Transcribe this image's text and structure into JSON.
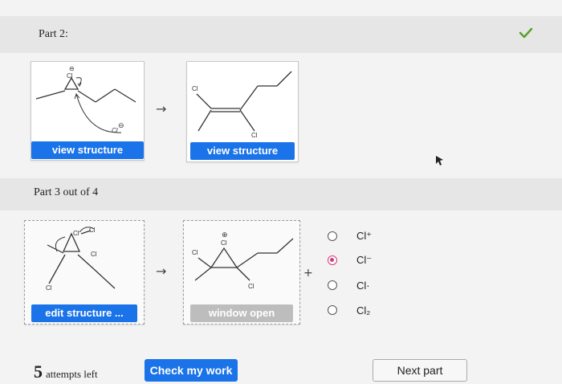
{
  "part2": {
    "title": "Part 2:",
    "check_icon": "checkmark-icon",
    "btn1": "view structure",
    "btn2": "view structure",
    "arrow": "→"
  },
  "part3": {
    "title": "Part 3 out of 4",
    "edit_button": "edit structure ...",
    "window_button": "window open",
    "arrow": "→",
    "plus": "+",
    "options": [
      {
        "label": "Cl⁺",
        "selected": false
      },
      {
        "label": "Cl⁻",
        "selected": true
      },
      {
        "label": "Cl·",
        "selected": false
      },
      {
        "label": "Cl₂",
        "selected": false
      }
    ]
  },
  "chem": {
    "cl": "Cl",
    "cl_minus": "Cl",
    "charge_minus": "⊖",
    "charge_plus": "⊕"
  },
  "footer": {
    "attempts_count": "5",
    "attempts_text": "attempts left",
    "check_button": "Check my work",
    "next_button": "Next part"
  },
  "colors": {
    "accent": "#1a73e8",
    "selected_radio": "#d23a7c",
    "check": "#5aa02c"
  }
}
